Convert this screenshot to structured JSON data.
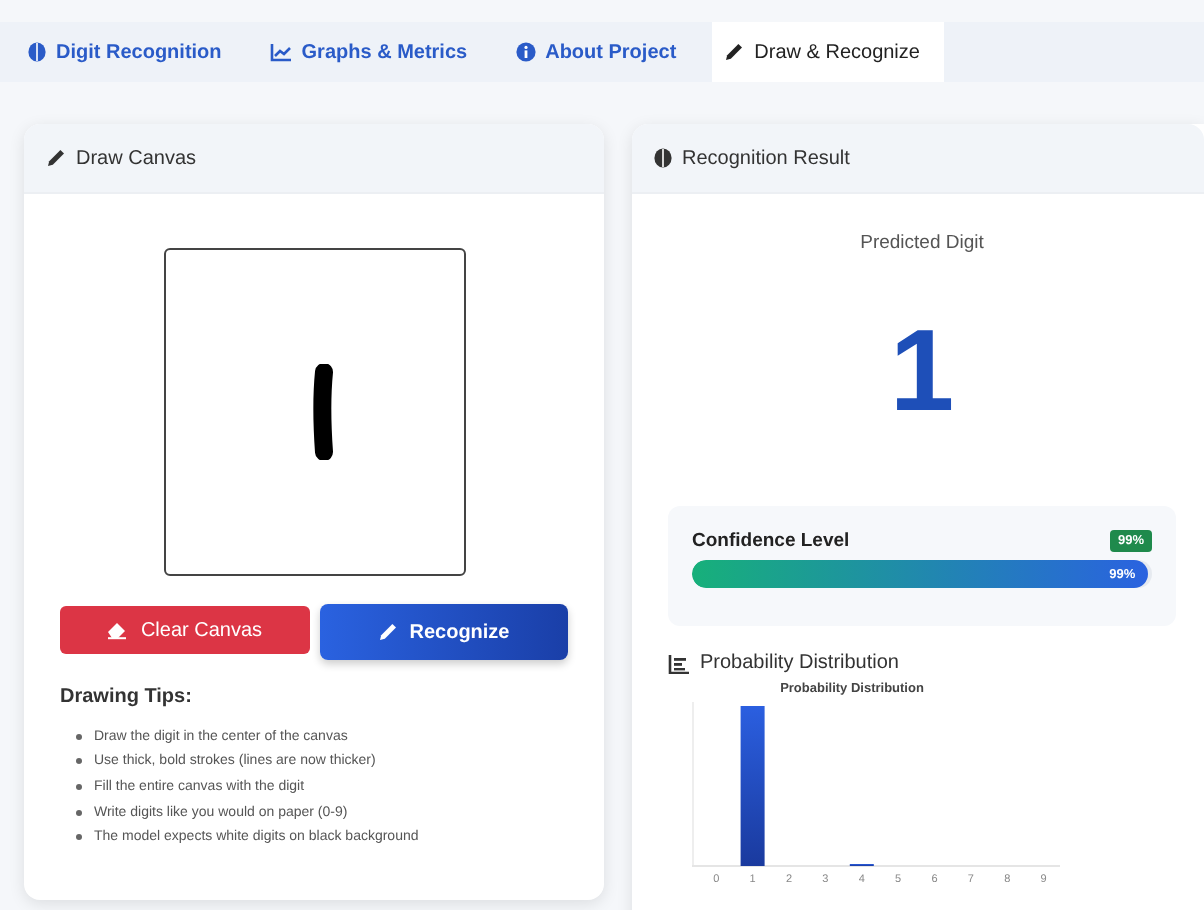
{
  "tabs": [
    {
      "label": "Digit Recognition",
      "kind": "brain",
      "selected": false
    },
    {
      "label": "Graphs & Metrics",
      "kind": "chart",
      "selected": false
    },
    {
      "label": "About Project",
      "kind": "info",
      "selected": false
    },
    {
      "label": "Draw & Recognize",
      "kind": "pencil",
      "selected": true
    }
  ],
  "draw_panel": {
    "title": "Draw Canvas",
    "buttons": [
      {
        "label": "Clear Canvas",
        "kind": "clear"
      },
      {
        "label": "Recognize",
        "kind": "recognize"
      }
    ],
    "tips_title": "Drawing Tips:",
    "tips": [
      "Draw the digit in the center of the canvas",
      "Use thick, bold strokes (lines are now thicker)",
      "Fill the entire canvas with the digit",
      "Write digits like you would on paper (0-9)",
      "The model expects white digits on black background"
    ]
  },
  "result_panel": {
    "title": "Recognition Result",
    "predicted_label": "Predicted Digit",
    "predicted_digit": "1",
    "confidence": {
      "label": "Confidence Level",
      "badge": "99%",
      "level": 0.99,
      "reading": "99%"
    },
    "distribution_title": "Probability Distribution",
    "chart_title": "Probability Distribution",
    "categories": [
      "0",
      "1",
      "2",
      "3",
      "4",
      "5",
      "6",
      "7",
      "8",
      "9"
    ]
  }
}
